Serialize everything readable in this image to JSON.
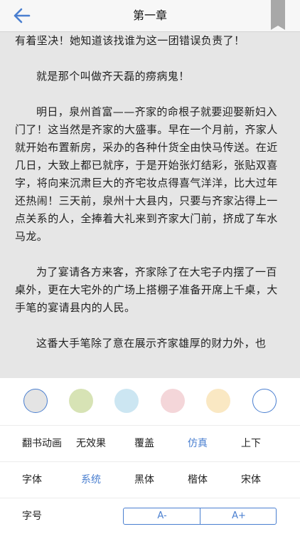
{
  "header": {
    "title": "第一章",
    "back_icon": "back-arrow-icon",
    "bookmark_icon": "bookmark-icon"
  },
  "content": {
    "paragraphs": [
      "有着坚决！她知道该找谁为这一团错误负责了！",
      "就是那个叫做齐天磊的痨病鬼！",
      "明日，泉州首富——齐家的命根子就要迎娶新妇入门了！这当然是齐家的大盛事。早在一个月前，齐家人就开始布置新房，采办的各种什货全由快马传送。在近几日，大致上都已就序，于是开始张灯结彩，张贴双喜字，将向来沉肃巨大的齐宅妆点得喜气洋洋，比大过年还热闹！三天前，泉州十大县内，只要与齐家沾得上一点关系的人，全捧着大礼来到齐家大门前，挤成了车水马龙。",
      "为了宴请各方来客，齐家除了在大宅子内摆了一百桌外，更在大宅外的广场上搭棚子准备开席上千桌，大手笔的宴请县内的人民。",
      "这番大手笔除了意在展示齐家雄厚的财力外，也"
    ]
  },
  "settings": {
    "background_colors": [
      "#e4e4e4",
      "#d7e3b5",
      "#cce6f2",
      "#f4d6d9",
      "#fae8c3",
      "#ffffff"
    ],
    "selected_background": "#e4e4e4",
    "accent_color": "#4a7fd0",
    "page_turn": {
      "label": "翻书动画",
      "options": [
        "无效果",
        "覆盖",
        "仿真",
        "上下"
      ],
      "selected": "仿真"
    },
    "font": {
      "label": "字体",
      "options": [
        "系统",
        "黑体",
        "楷体",
        "宋体"
      ],
      "selected": "系统"
    },
    "font_size": {
      "label": "字号",
      "decrease": "A-",
      "increase": "A+"
    }
  }
}
